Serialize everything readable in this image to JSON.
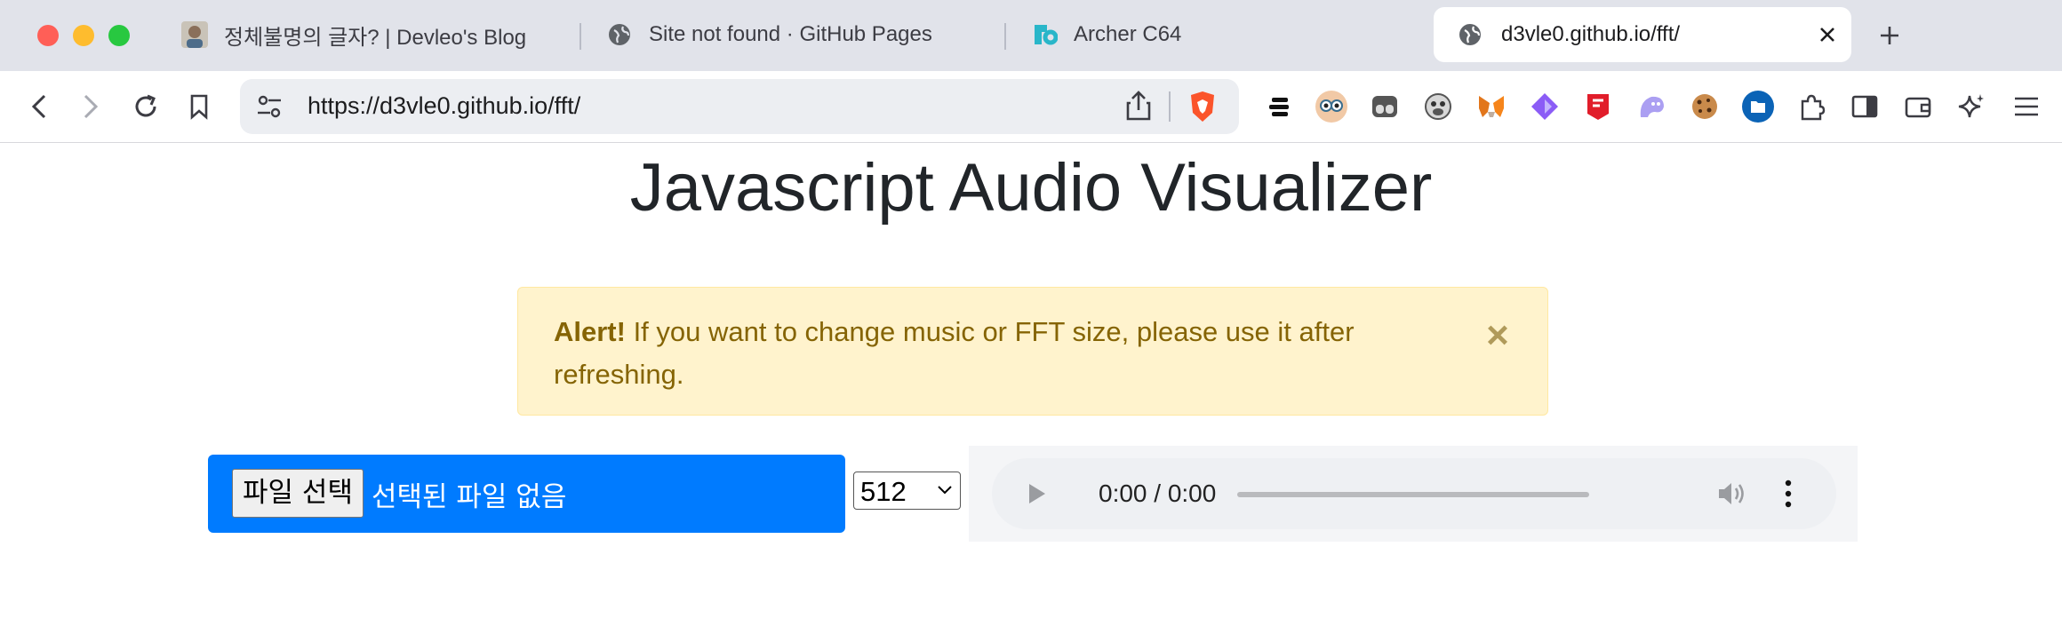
{
  "browser": {
    "tabs": [
      {
        "label": "정체불명의 글자? | Devleo's Blog",
        "icon": "avatar-favicon"
      },
      {
        "label": "Site not found · GitHub Pages",
        "icon": "globe-icon"
      },
      {
        "label": "Archer C64",
        "icon": "tplink-icon"
      }
    ],
    "active_tab": {
      "label": "d3vle0.github.io/fft/",
      "icon": "globe-icon"
    },
    "url": "https://d3vle0.github.io/fft/"
  },
  "page": {
    "title": "Javascript Audio Visualizer",
    "alert": {
      "strong": "Alert!",
      "message": " If you want to change music or FFT size, please use it after refreshing.",
      "close": "×"
    },
    "file_input": {
      "button_label": "파일 선택",
      "status": "선택된 파일 없음"
    },
    "fft_select": {
      "value": "512"
    },
    "audio": {
      "time": "0:00 / 0:00"
    }
  },
  "colors": {
    "accent": "#007bff",
    "alert_bg": "#fff3cd",
    "alert_text": "#856404"
  }
}
